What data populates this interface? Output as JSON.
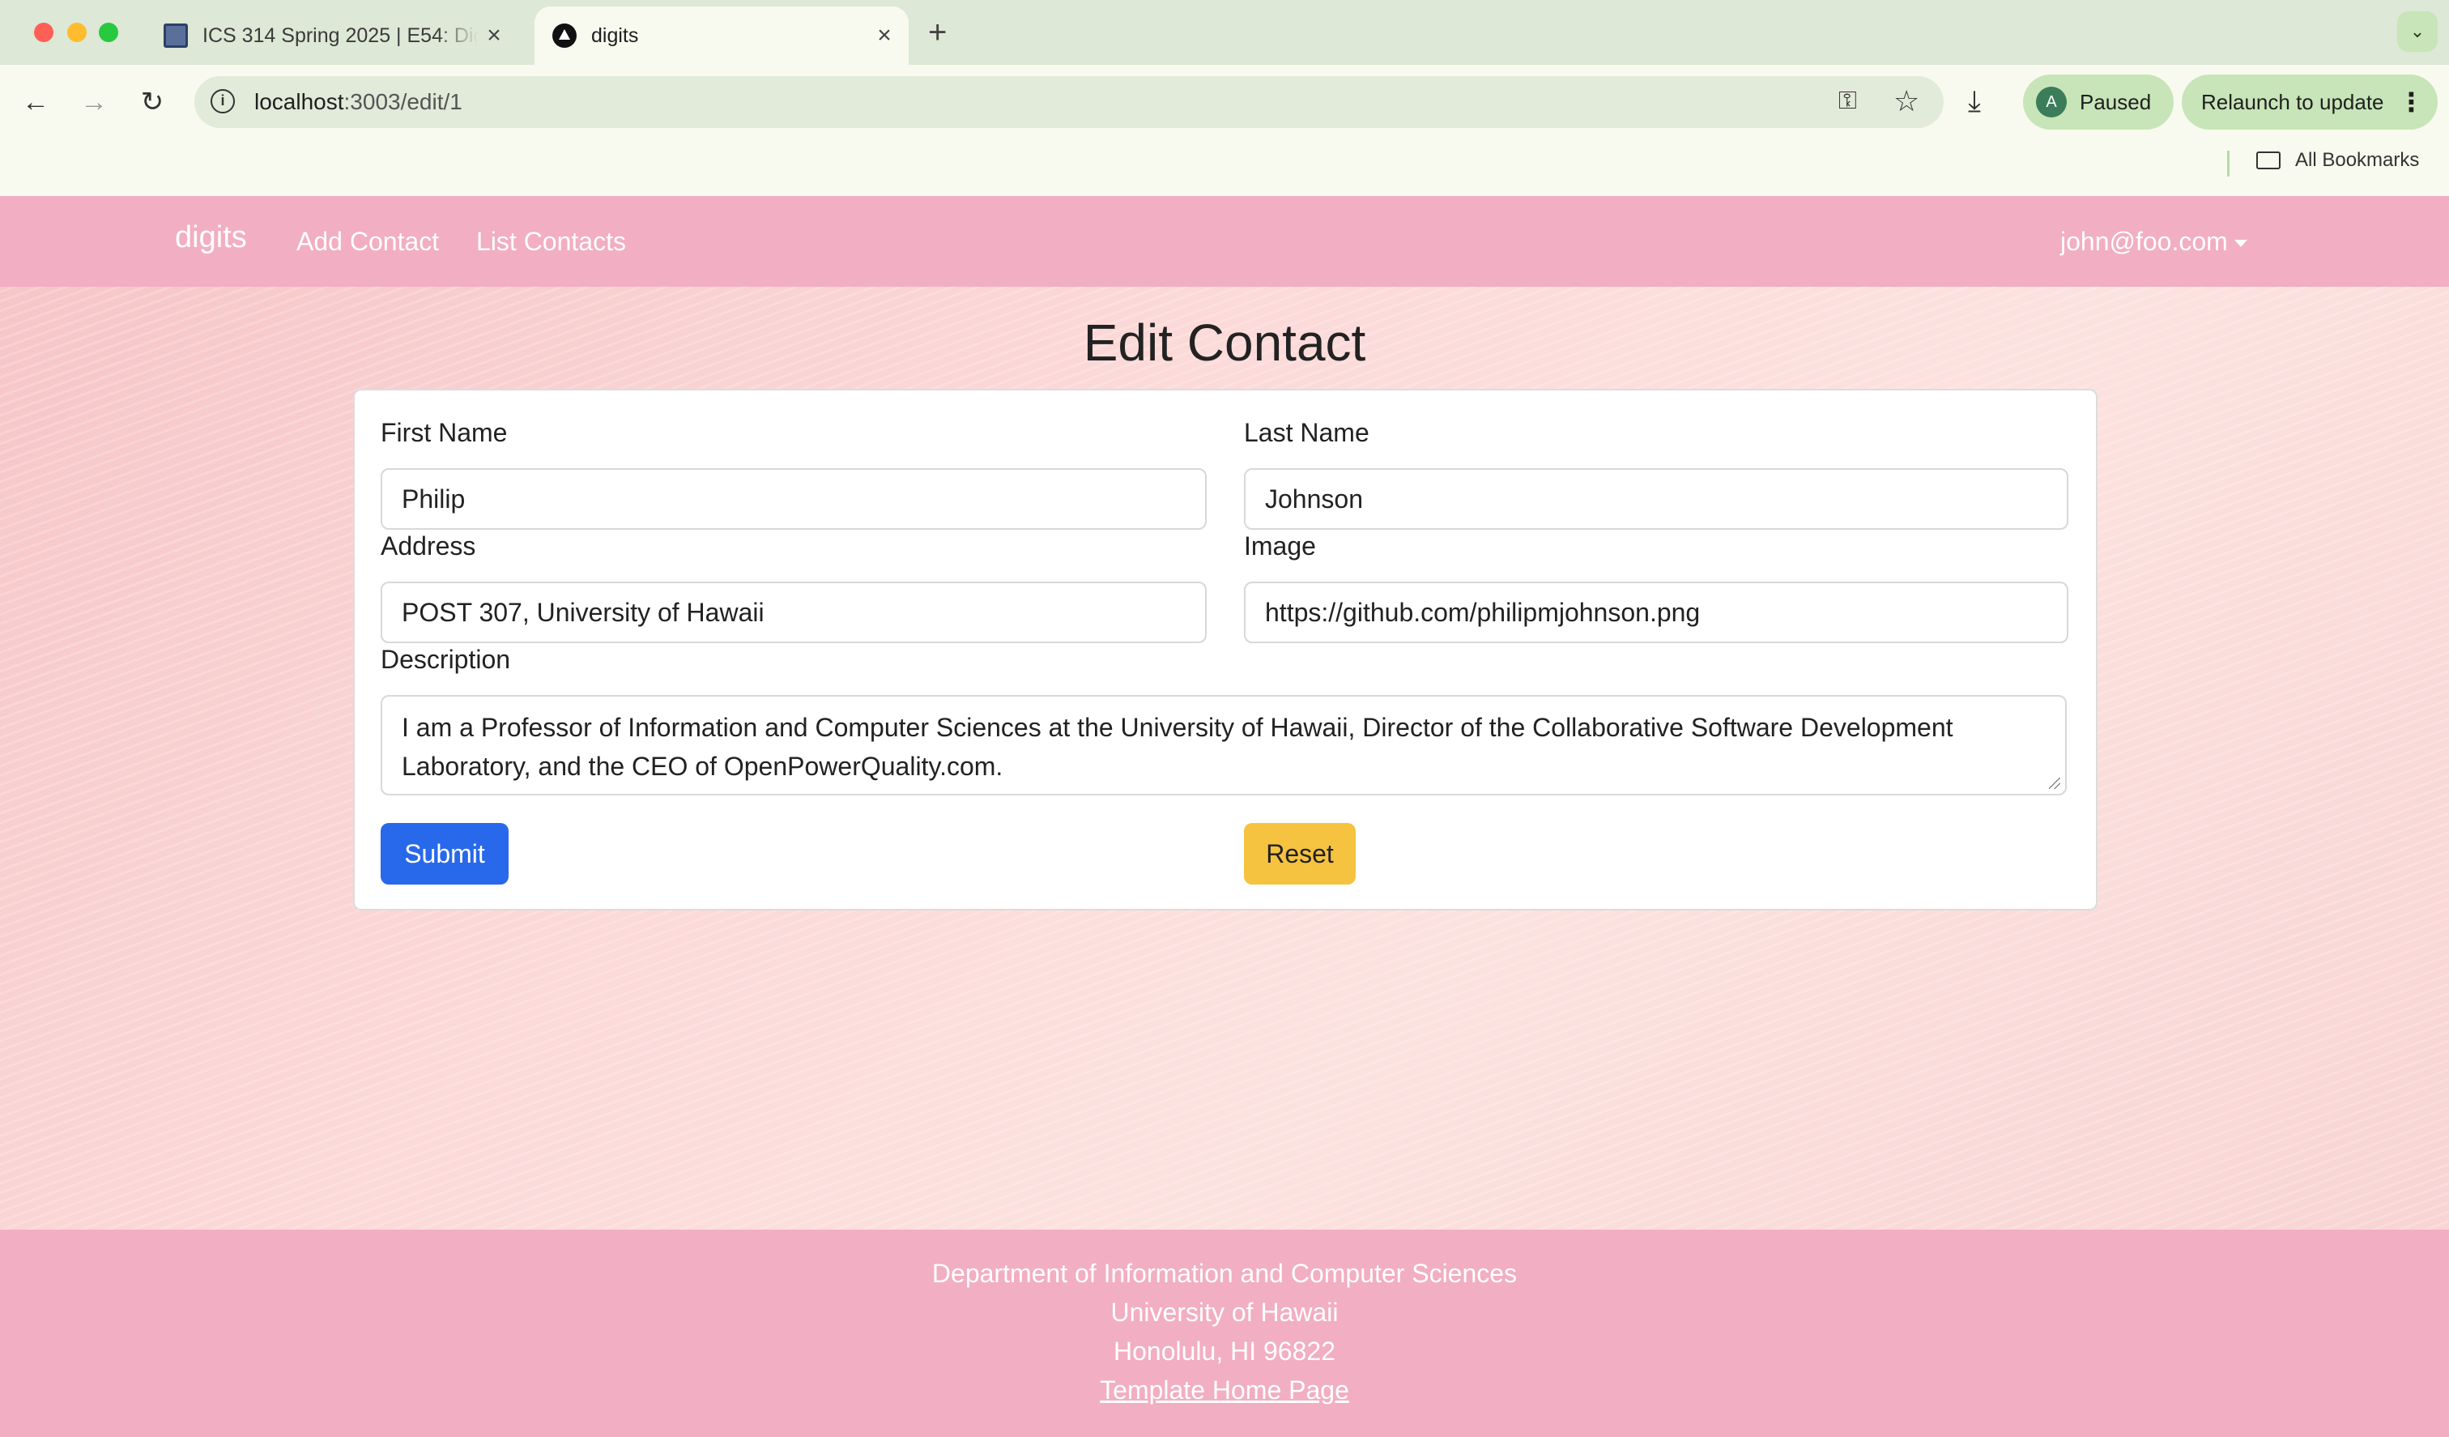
{
  "browser": {
    "tabs": [
      {
        "title": "ICS 314 Spring 2025 | E54: Digits",
        "active": false
      },
      {
        "title": "digits",
        "active": true
      }
    ],
    "url_host": "localhost",
    "url_path": ":3003/edit/1",
    "profile_initial": "A",
    "profile_status": "Paused",
    "relaunch_label": "Relaunch to update",
    "bookmarks_label": "All Bookmarks"
  },
  "nav": {
    "brand": "digits",
    "links": [
      "Add Contact",
      "List Contacts"
    ],
    "user": "john@foo.com"
  },
  "form": {
    "heading": "Edit Contact",
    "first_name_label": "First Name",
    "first_name_value": "Philip",
    "last_name_label": "Last Name",
    "last_name_value": "Johnson",
    "address_label": "Address",
    "address_value": "POST 307, University of Hawaii",
    "image_label": "Image",
    "image_value": "https://github.com/philipmjohnson.png",
    "description_label": "Description",
    "description_value": "I am a Professor of Information and Computer Sciences at the University of Hawaii, Director of the Collaborative Software Development Laboratory, and the CEO of OpenPowerQuality.com.",
    "submit_label": "Submit",
    "reset_label": "Reset"
  },
  "footer": {
    "line1": "Department of Information and Computer Sciences",
    "line2": "University of Hawaii",
    "line3": "Honolulu, HI 96822",
    "link": "Template Home Page"
  },
  "colors": {
    "navbar": "#f2aec3",
    "submit": "#2868ea",
    "reset": "#f5c33f"
  }
}
